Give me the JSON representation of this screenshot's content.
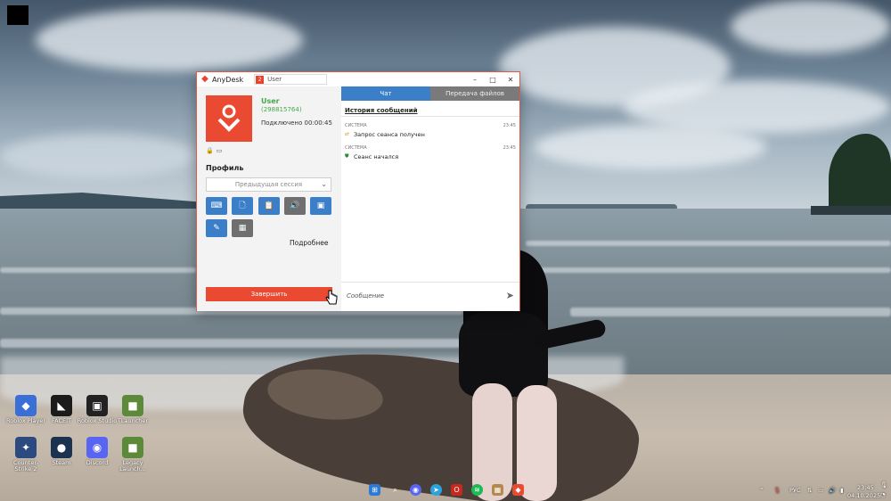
{
  "window": {
    "app_name": "AnyDesk",
    "tab_badge": "2",
    "tab_label": "User",
    "controls": {
      "minimize": "–",
      "maximize": "□",
      "close": "✕"
    }
  },
  "session": {
    "user_name": "User",
    "user_id": "(298815764)",
    "connected_label": "Подключено 00:00:45"
  },
  "profile": {
    "label": "Профиль",
    "selected": "Предыдущая сессия"
  },
  "more_link": "Подробнее",
  "end_button": "Завершить",
  "chat": {
    "tab_chat": "Чат",
    "tab_files": "Передача файлов",
    "history_title": "История сообщений",
    "messages": [
      {
        "sender": "СИСТЕМА",
        "time": "23:45",
        "text": "Запрос сеанса получен"
      },
      {
        "sender": "СИСТЕМА",
        "time": "23:45",
        "text": "Сеанс начался"
      }
    ],
    "input_placeholder": "Сообщение"
  },
  "desktop_icons": [
    {
      "label": "Roblox Player",
      "color": "#3a6fd8",
      "glyph": "◆"
    },
    {
      "label": "FACEIT",
      "color": "#1b1b1b",
      "glyph": "◣"
    },
    {
      "label": "Roblox Studio",
      "color": "#222222",
      "glyph": "▣"
    },
    {
      "label": "TLauncher",
      "color": "#5d8a3a",
      "glyph": "■"
    },
    {
      "label": "Counter-Strike 2",
      "color": "#2a4a80",
      "glyph": "✦"
    },
    {
      "label": "Steam",
      "color": "#1b3350",
      "glyph": "●"
    },
    {
      "label": "Discord",
      "color": "#5865f2",
      "glyph": "◉"
    },
    {
      "label": "Legacy Launch...",
      "color": "#5d8a3a",
      "glyph": "■"
    }
  ],
  "tray": {
    "language": "РУС",
    "time": "23:45",
    "date": "04.10.2025"
  },
  "colors": {
    "anydesk_red": "#ea4a31",
    "accent_blue": "#3c7fc9",
    "status_green": "#46a74b"
  }
}
